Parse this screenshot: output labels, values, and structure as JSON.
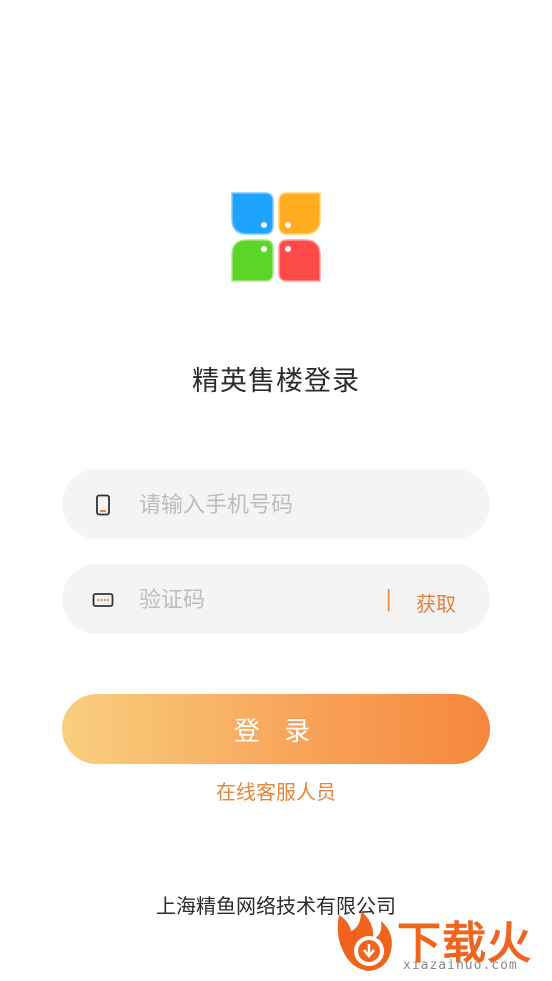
{
  "app": {
    "title": "精英售楼登录",
    "logo_icon": "four-petal-logo-icon",
    "logo_colors": [
      "#1ea4ff",
      "#ffac1f",
      "#5dd42a",
      "#ff4a4a"
    ]
  },
  "form": {
    "phone": {
      "placeholder": "请输入手机号码",
      "value": "",
      "icon": "phone-icon"
    },
    "code": {
      "placeholder": "验证码",
      "value": "",
      "icon": "password-dots-icon",
      "separator": "|",
      "get_label": "获取"
    },
    "login_label": "登 录",
    "support_label": "在线客服人员"
  },
  "footer": {
    "company": "上海精鱼网络技术有限公司"
  },
  "watermark": {
    "text": "下载火",
    "url": "xiazaihuo.com"
  },
  "colors": {
    "accent": "#e8843a",
    "button_start": "#f9cf7e",
    "button_end": "#f6873c",
    "field_bg": "#f4f4f4"
  }
}
